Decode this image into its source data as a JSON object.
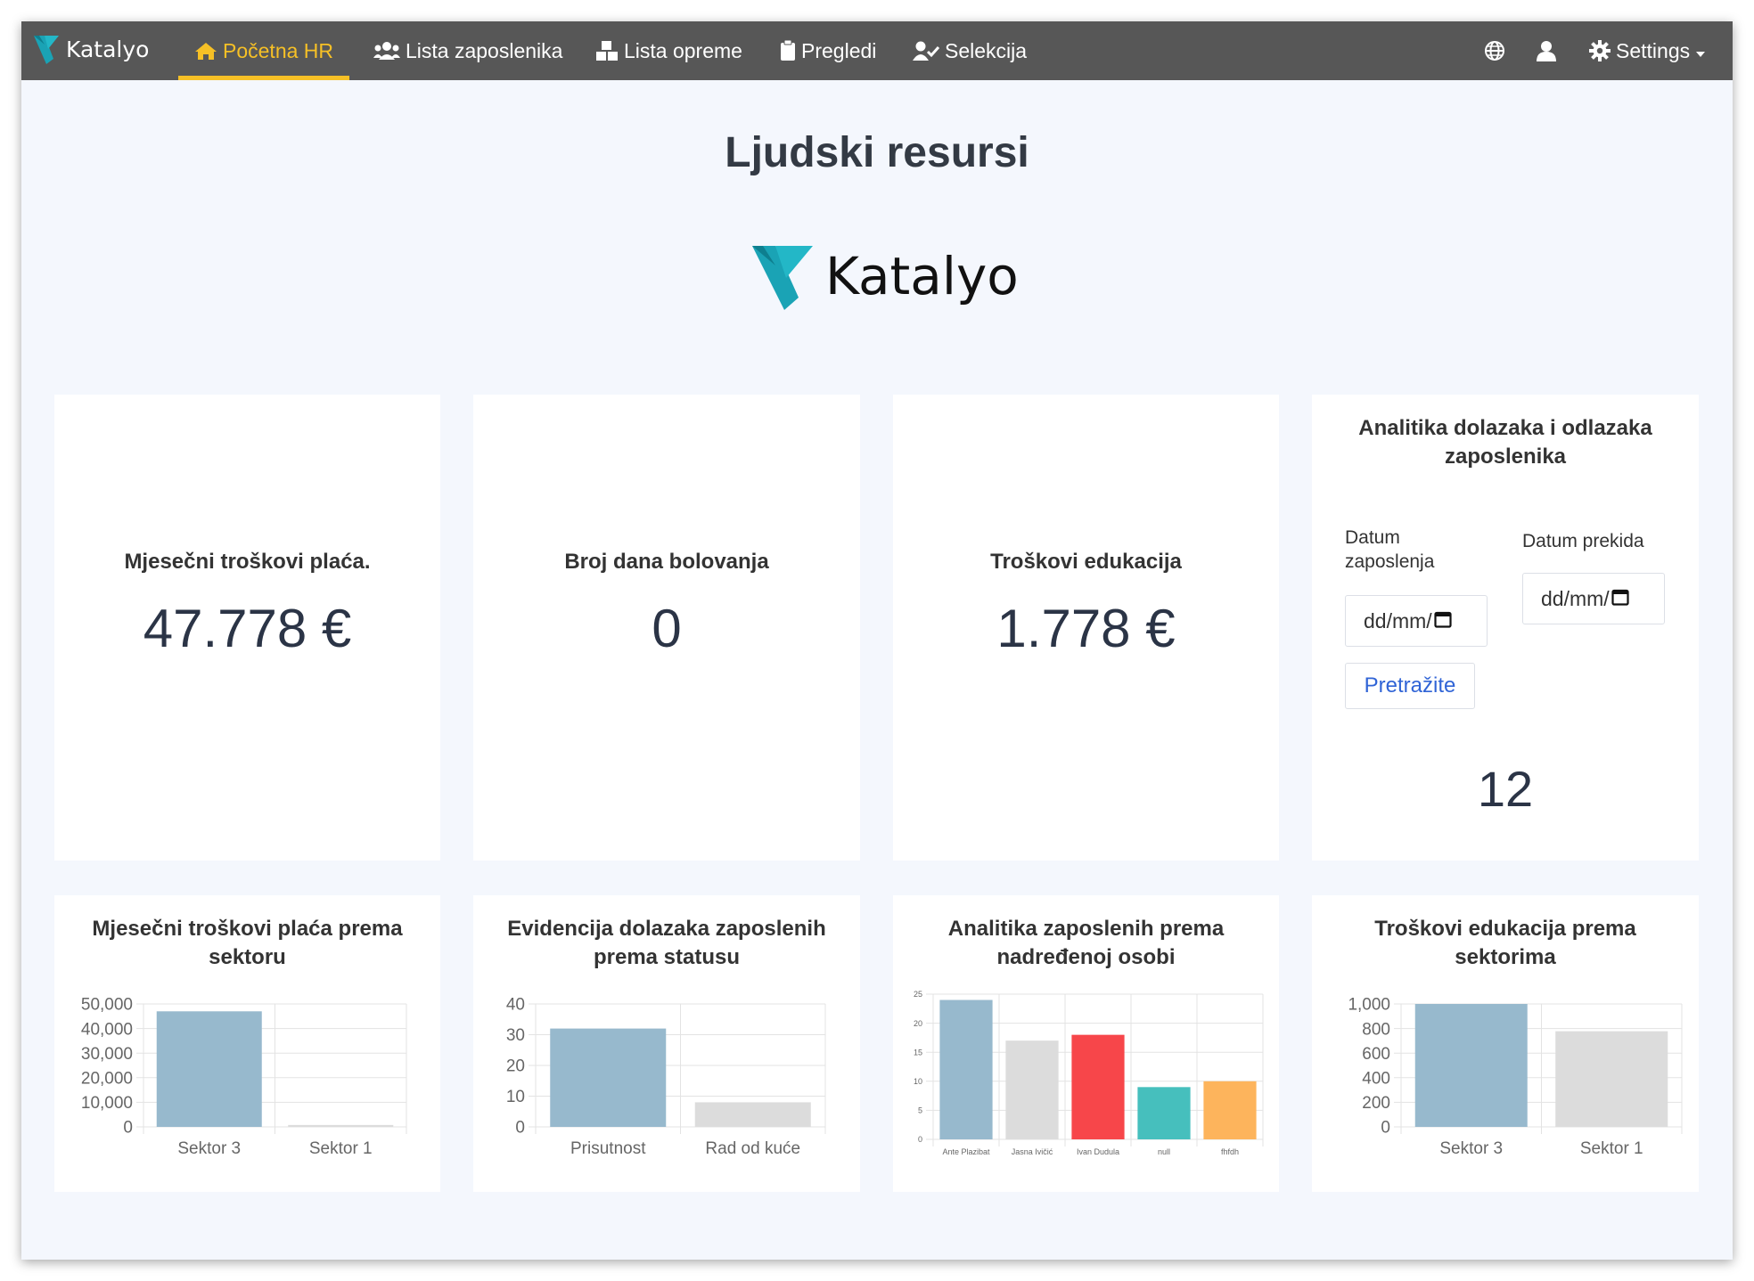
{
  "navbar": {
    "brand": "Katalyo",
    "items": [
      {
        "label": "Početna HR",
        "icon": "home-icon",
        "active": true
      },
      {
        "label": "Lista zaposlenika",
        "icon": "users-icon",
        "active": false
      },
      {
        "label": "Lista opreme",
        "icon": "boxes-icon",
        "active": false
      },
      {
        "label": "Pregledi",
        "icon": "clipboard-icon",
        "active": false
      },
      {
        "label": "Selekcija",
        "icon": "user-check-icon",
        "active": false
      }
    ],
    "right": {
      "globe_icon": "globe-icon",
      "user_icon": "user-icon",
      "settings_label": "Settings",
      "settings_icon": "gear-icon"
    }
  },
  "page": {
    "title": "Ljudski resursi",
    "logo_text": "Katalyo"
  },
  "kpis": [
    {
      "title": "Mjesečni troškovi plaća.",
      "value": "47.778 €"
    },
    {
      "title": "Broj dana bolovanja",
      "value": "0"
    },
    {
      "title": "Troškovi edukacija",
      "value": "1.778 €"
    }
  ],
  "attendance_panel": {
    "title": "Analitika dolazaka i odlazaka zaposlenika",
    "start_label": "Datum zaposlenja",
    "end_label": "Datum prekida",
    "start_value": "dd/mm/",
    "end_value": "dd/mm/",
    "search_label": "Pretražite",
    "result": "12"
  },
  "chart_data": [
    {
      "type": "bar",
      "title": "Mjesečni troškovi plaća prema sektoru",
      "categories": [
        "Sektor 3",
        "Sektor 1"
      ],
      "values": [
        47000,
        778
      ],
      "colors": [
        "#97b9cd",
        "#dcdcdc"
      ],
      "ylim": [
        0,
        50000
      ],
      "yticks": [
        "0",
        "10,000",
        "20,000",
        "30,000",
        "40,000",
        "50,000"
      ]
    },
    {
      "type": "bar",
      "title": "Evidencija dolazaka zaposlenih prema statusu",
      "categories": [
        "Prisutnost",
        "Rad od kuće"
      ],
      "values": [
        32,
        8
      ],
      "colors": [
        "#97b9cd",
        "#dcdcdc"
      ],
      "ylim": [
        0,
        40
      ],
      "yticks": [
        "0",
        "10",
        "20",
        "30",
        "40"
      ]
    },
    {
      "type": "bar",
      "title": "Analitika zaposlenih prema nadređenoj osobi",
      "categories": [
        "Ante Plazibat",
        "Jasna Ivičić",
        "Ivan Dudula",
        "null",
        "fhfdh"
      ],
      "values": [
        24,
        17,
        18,
        9,
        10
      ],
      "colors": [
        "#97b9cd",
        "#dcdcdc",
        "#f7464a",
        "#46bfbd",
        "#fdb45c"
      ],
      "ylim": [
        0,
        25
      ],
      "yticks": [
        "0",
        "5",
        "10",
        "15",
        "20",
        "25"
      ]
    },
    {
      "type": "bar",
      "title": "Troškovi edukacija prema sektorima",
      "categories": [
        "Sektor 3",
        "Sektor 1"
      ],
      "values": [
        1000,
        778
      ],
      "colors": [
        "#97b9cd",
        "#dcdcdc"
      ],
      "ylim": [
        0,
        1000
      ],
      "yticks": [
        "0",
        "200",
        "400",
        "600",
        "800",
        "1,000"
      ]
    }
  ]
}
